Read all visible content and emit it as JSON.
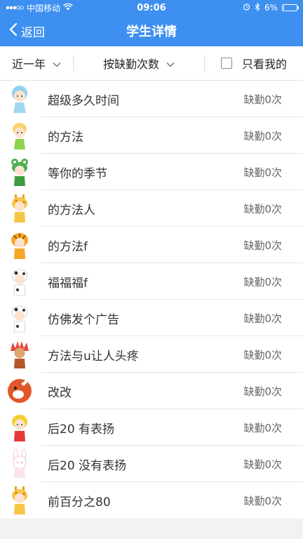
{
  "status": {
    "carrier": "中国移动",
    "time": "09:06",
    "battery": "6%",
    "battery_level": 0.06
  },
  "nav": {
    "back": "返回",
    "title": "学生详情"
  },
  "filters": {
    "range": "近一年",
    "sort": "按缺勤次数",
    "only_mine": "只看我的"
  },
  "students": [
    {
      "name": "超级多久时间",
      "absent": "缺勤0次",
      "avatar": "princess-avatar"
    },
    {
      "name": "的方法",
      "absent": "缺勤0次",
      "avatar": "fairy-avatar"
    },
    {
      "name": "等你的季节",
      "absent": "缺勤0次",
      "avatar": "frog-avatar"
    },
    {
      "name": "的方法人",
      "absent": "缺勤0次",
      "avatar": "giraffe-avatar"
    },
    {
      "name": "的方法f",
      "absent": "缺勤0次",
      "avatar": "tiger-avatar"
    },
    {
      "name": "福福福f",
      "absent": "缺勤0次",
      "avatar": "cow-avatar"
    },
    {
      "name": "仿佛发个广告",
      "absent": "缺勤0次",
      "avatar": "cow-avatar"
    },
    {
      "name": "方法与u让人头疼",
      "absent": "缺勤0次",
      "avatar": "indian-avatar"
    },
    {
      "name": "改改",
      "absent": "缺勤0次",
      "avatar": "deer-avatar"
    },
    {
      "name": "后20 有表扬",
      "absent": "缺勤0次",
      "avatar": "girl-avatar"
    },
    {
      "name": "后20 没有表扬",
      "absent": "缺勤0次",
      "avatar": "rabbit-avatar"
    },
    {
      "name": "前百分之80",
      "absent": "缺勤0次",
      "avatar": "giraffe-avatar"
    }
  ],
  "colors": {
    "header": "#3d8ff0"
  }
}
